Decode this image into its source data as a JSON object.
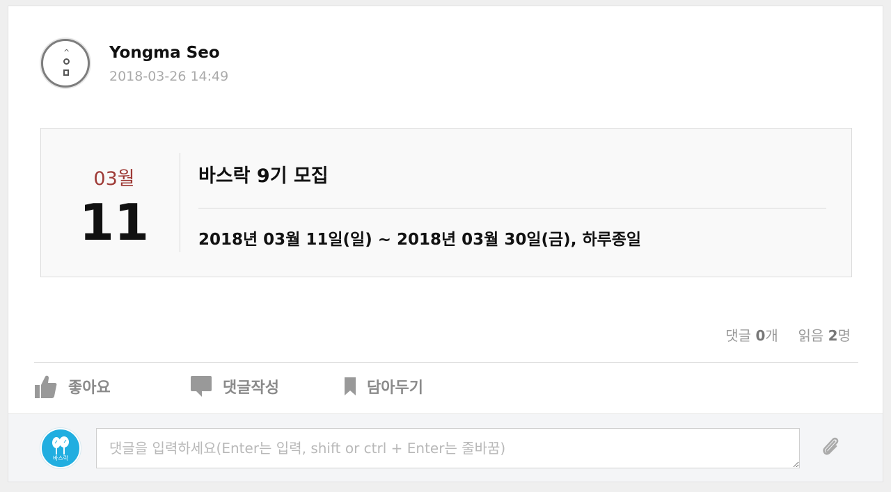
{
  "post": {
    "author": "Yongma Seo",
    "timestamp": "2018-03-26 14:49",
    "avatar_icon": "profile-glyph-icon"
  },
  "event": {
    "month": "03월",
    "day": "11",
    "title": "바스락 9기 모집",
    "date_range": "2018년 03월 11일(일) ~ 2018년 03월 30일(금), 하루종일",
    "month_color": "#9e3a36"
  },
  "stats": {
    "comments_label": "댓글",
    "comments_count": "0",
    "comments_unit": "개",
    "reads_label": "읽음",
    "reads_count": "2",
    "reads_unit": "명"
  },
  "actions": {
    "like": "좋아요",
    "comment": "댓글작성",
    "save": "담아두기"
  },
  "comment_box": {
    "avatar_label": "바스락",
    "avatar_color": "#21aee0",
    "placeholder": "댓글을 입력하세요(Enter는 입력, shift or ctrl + Enter는 줄바꿈)",
    "value": ""
  }
}
